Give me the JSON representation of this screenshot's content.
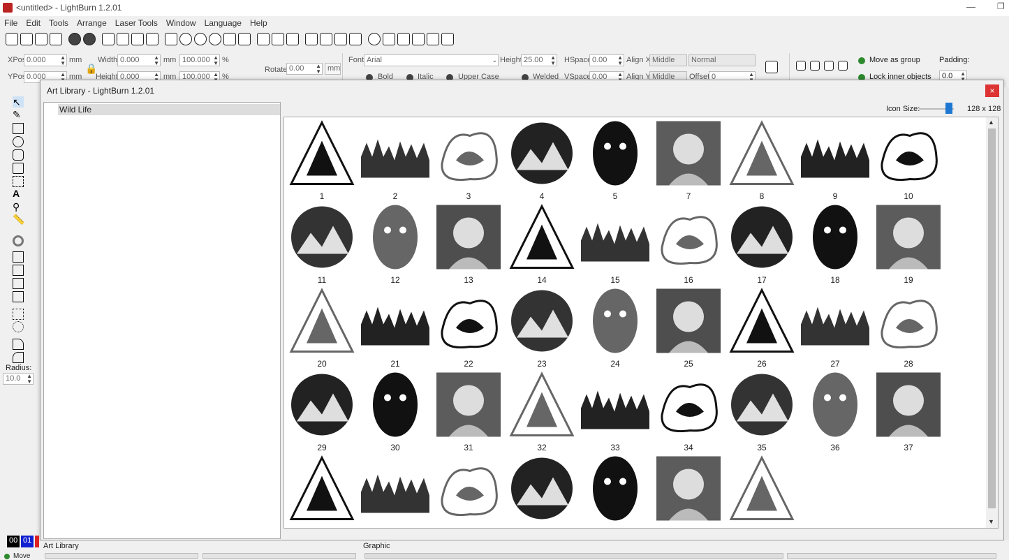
{
  "window": {
    "title": "<untitled> - LightBurn 1.2.01"
  },
  "menu": [
    "File",
    "Edit",
    "Tools",
    "Arrange",
    "Laser Tools",
    "Window",
    "Language",
    "Help"
  ],
  "props": {
    "xpos_label": "XPos",
    "xpos": "0.000",
    "ypos_label": "YPos",
    "ypos": "0.000",
    "unit": "mm",
    "width_label": "Width",
    "width": "0.000",
    "height_label": "Height",
    "height": "0.000",
    "scale_w": "100.000",
    "scale_h": "100.000",
    "pct": "%",
    "rotate_label": "Rotate",
    "rotate": "0.00",
    "mm_button": "mm",
    "font_label": "Font",
    "font": "Arial",
    "fheight_label": "Height",
    "fheight": "25.00",
    "hspace_label": "HSpace",
    "hspace": "0.00",
    "vspace_label": "VSpace",
    "vspace": "0.00",
    "alignx_label": "Align X",
    "alignx": "Middle",
    "aligny_label": "Align Y",
    "aligny": "Middle",
    "normal": "Normal",
    "offset_label": "Offset",
    "offset": "0",
    "bold": "Bold",
    "italic": "Italic",
    "upper": "Upper Case",
    "welded": "Welded",
    "move_group": "Move as group",
    "lock_inner": "Lock inner objects",
    "padding_label": "Padding:",
    "padding": "0.0"
  },
  "tools": {
    "radius_label": "Radius:",
    "radius": "10.0"
  },
  "dialog": {
    "title": "Art Library - LightBurn 1.2.01",
    "close": "×",
    "category": "Wild Life",
    "icon_size_label": "Icon Size:",
    "icon_size_value": "128 x 128",
    "icon_size_fraction": 0.85
  },
  "gallery": {
    "items": [
      {
        "label": "1"
      },
      {
        "label": "2"
      },
      {
        "label": "3"
      },
      {
        "label": "4"
      },
      {
        "label": "5"
      },
      {
        "label": "7"
      },
      {
        "label": "8"
      },
      {
        "label": "9"
      },
      {
        "label": "10"
      },
      {
        "label": "11"
      },
      {
        "label": "12"
      },
      {
        "label": "13"
      },
      {
        "label": "14"
      },
      {
        "label": "15"
      },
      {
        "label": "16"
      },
      {
        "label": "17"
      },
      {
        "label": "18"
      },
      {
        "label": "19"
      },
      {
        "label": "20"
      },
      {
        "label": "21"
      },
      {
        "label": "22"
      },
      {
        "label": "23"
      },
      {
        "label": "24"
      },
      {
        "label": "25"
      },
      {
        "label": "26"
      },
      {
        "label": "27"
      },
      {
        "label": "28"
      },
      {
        "label": "29"
      },
      {
        "label": "30"
      },
      {
        "label": "31"
      },
      {
        "label": "32"
      },
      {
        "label": "33"
      },
      {
        "label": "34"
      },
      {
        "label": "35"
      },
      {
        "label": "36"
      },
      {
        "label": "37"
      },
      {
        "label": ""
      },
      {
        "label": ""
      },
      {
        "label": ""
      },
      {
        "label": ""
      },
      {
        "label": ""
      },
      {
        "label": ""
      },
      {
        "label": ""
      }
    ]
  },
  "bottom": {
    "layer_00": "00",
    "layer_01": "01",
    "move": "Move",
    "art_library_tab": "Art Library",
    "graphic_tab": "Graphic"
  }
}
